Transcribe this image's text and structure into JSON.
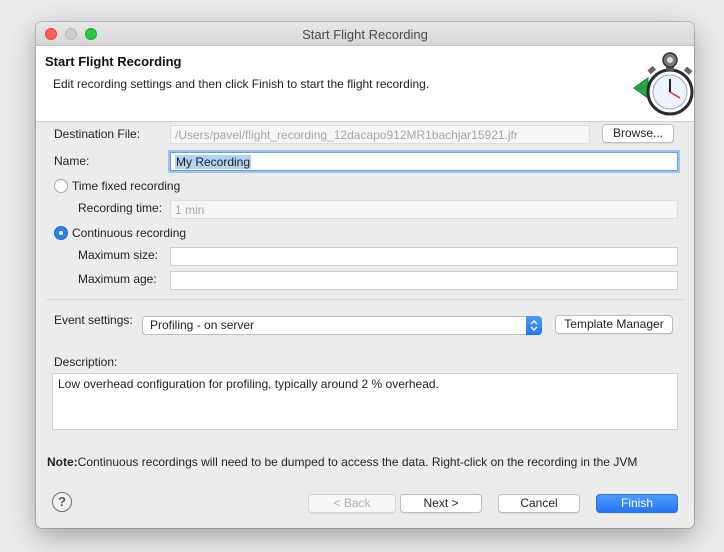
{
  "window": {
    "title": "Start Flight Recording"
  },
  "banner": {
    "title": "Start Flight Recording",
    "description": "Edit recording settings and then click Finish to start the flight recording.",
    "icon": "stopwatch-recording-icon"
  },
  "form": {
    "destination_label": "Destination File:",
    "destination_value": "/Users/pavel/flight_recording_12dacapo912MR1bachjar15921.jfr",
    "browse_label": "Browse...",
    "name_label": "Name:",
    "name_value": "My Recording",
    "time_fixed_label": "Time fixed recording",
    "time_fixed_selected": false,
    "recording_time_label": "Recording time:",
    "recording_time_placeholder": "1 min",
    "continuous_label": "Continuous recording",
    "continuous_selected": true,
    "max_size_label": "Maximum size:",
    "max_size_value": "",
    "max_age_label": "Maximum age:",
    "max_age_value": ""
  },
  "events": {
    "label": "Event settings:",
    "selected": "Profiling - on server",
    "template_manager_label": "Template Manager"
  },
  "description": {
    "label": "Description:",
    "text": "Low overhead configuration for profiling, typically around 2 % overhead."
  },
  "note": {
    "prefix": "Note:",
    "text": "Continuous recordings will need to be dumped to access the data. Right-click on the recording in the JVM"
  },
  "footer": {
    "help_icon": "help-icon",
    "back_label": "< Back",
    "next_label": "Next >",
    "cancel_label": "Cancel",
    "finish_label": "Finish"
  },
  "colors": {
    "accent": "#2b7ff0",
    "close": "#fc5f57",
    "maximize": "#28c840"
  }
}
